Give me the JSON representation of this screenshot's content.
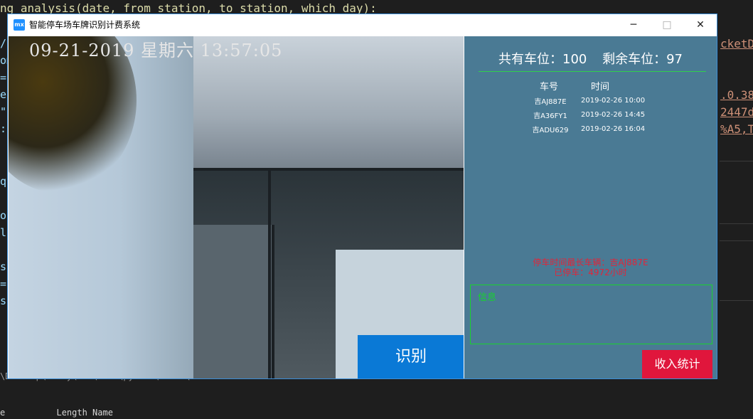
{
  "background_editor": {
    "top_line": "ng analysis(date, from station, to station, which day):",
    "right_fragments": [
      "cketD",
      ".0.38",
      "2447d",
      "%A5,T"
    ],
    "left_chars": [
      "/",
      "om",
      "=",
      "e",
      "\"",
      ":",
      "q",
      "",
      "o",
      "l",
      "",
      "s",
      "=",
      "s"
    ],
    "path_line": "\\Desktop\\Study\\Git\\Hanz\\python\\tools\\carNumber",
    "table_header": "e          Length Name"
  },
  "window": {
    "icon_label": "mx",
    "title": "智能停车场车牌识别计费系统",
    "minimize": "─",
    "maximize": "□",
    "close": "✕"
  },
  "camera": {
    "timestamp": "09-21-2019 星期六 13:57:05",
    "recognize_button": "识别"
  },
  "panel": {
    "total_label": "共有车位：100",
    "remaining_label": "剩余车位：97",
    "records_header": {
      "plate": "车号",
      "time": "时间"
    },
    "records": [
      {
        "plate": "吉AJ887E",
        "time": "2019-02-26 10:00"
      },
      {
        "plate": "吉A36FY1",
        "time": "2019-02-26 14:45"
      },
      {
        "plate": "吉ADU629",
        "time": "2019-02-26 16:04"
      }
    ],
    "longest_line1": "停车时间最长车辆：吉AJ887E",
    "longest_line2": "已停车：4972小时",
    "info_label": "信息",
    "stats_button": "收入统计"
  },
  "colors": {
    "panel_bg": "#4a7a94",
    "recognize_blue": "#0a79d6",
    "stats_red": "#e0163c",
    "accent_green": "#1ad12f",
    "warning_red": "#e0253a"
  }
}
